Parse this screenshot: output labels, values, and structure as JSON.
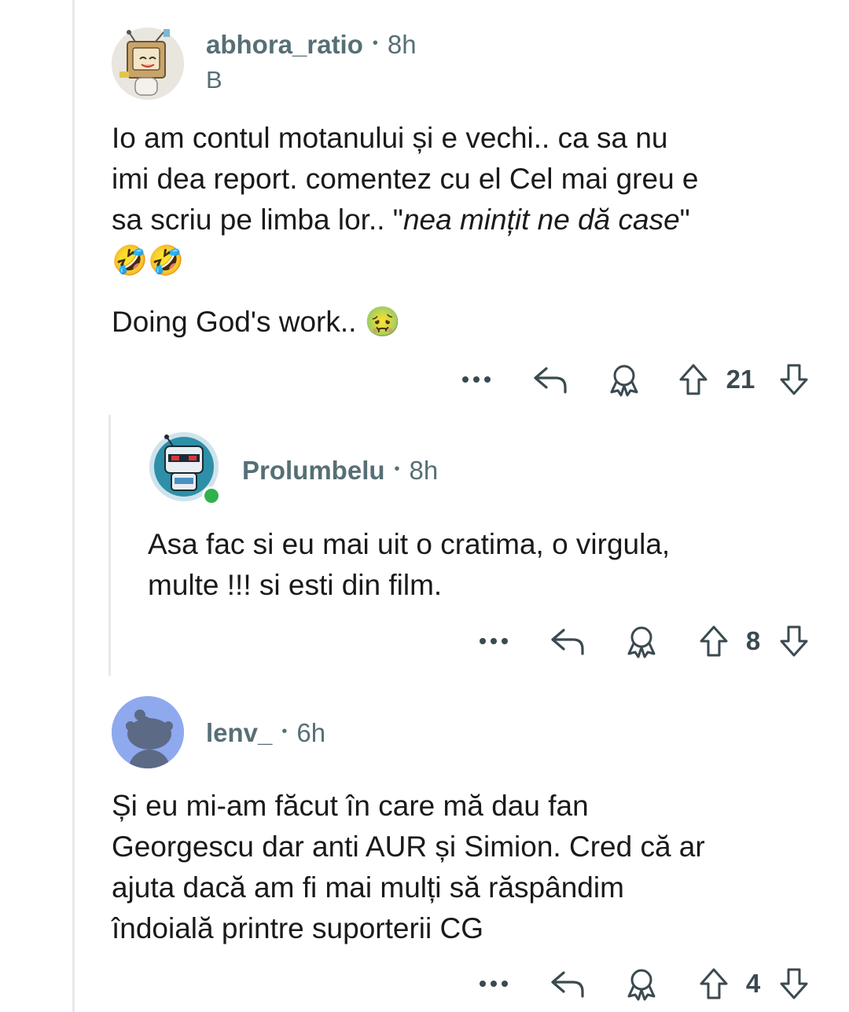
{
  "comments": [
    {
      "username": "abhora_ratio",
      "separator": "•",
      "time": "8h",
      "flair": "B",
      "avatar_icon": "tv-head-snoo-icon",
      "body": {
        "line1": "Io am contul motanului și e vechi.. ca sa nu",
        "line2": "imi dea report. comentez cu el Cel mai greu e",
        "line3_prefix": "sa scriu pe limba lor..  \"",
        "line3_italic": "nea mințit ne dă case",
        "line3_suffix": "\"",
        "line4_emoji": "🤣🤣",
        "line5": "Doing God's work.. ",
        "line5_emoji": "🤢"
      },
      "votes": "21",
      "more_label": "•••"
    },
    {
      "username": "Prolumbelu",
      "separator": "•",
      "time": "8h",
      "avatar_icon": "robot-snoo-icon",
      "online": true,
      "body": {
        "line1": "Asa fac si eu mai uit o cratima, o virgula,",
        "line2": "multe !!! si esti din film."
      },
      "votes": "8",
      "more_label": "•••"
    },
    {
      "username": "lenv_",
      "separator": "•",
      "time": "6h",
      "avatar_icon": "default-snoo-icon",
      "body": {
        "line1": "Și eu mi-am făcut în care mă dau fan",
        "line2": "Georgescu dar anti AUR și Simion. Cred că ar",
        "line3": "ajuta dacă am fi mai mulți să răspândim",
        "line4": "îndoială printre suporterii CG"
      },
      "votes": "4",
      "more_label": "•••"
    }
  ],
  "colors": {
    "meta_text": "#576f76",
    "body_text": "#1a1a1b",
    "thread_line": "#e6e8ea",
    "online_dot": "#2fb24c",
    "default_avatar_bg": "#8fa9ef"
  },
  "icons": [
    "more-icon",
    "reply-icon",
    "award-icon",
    "upvote-icon",
    "downvote-icon"
  ]
}
